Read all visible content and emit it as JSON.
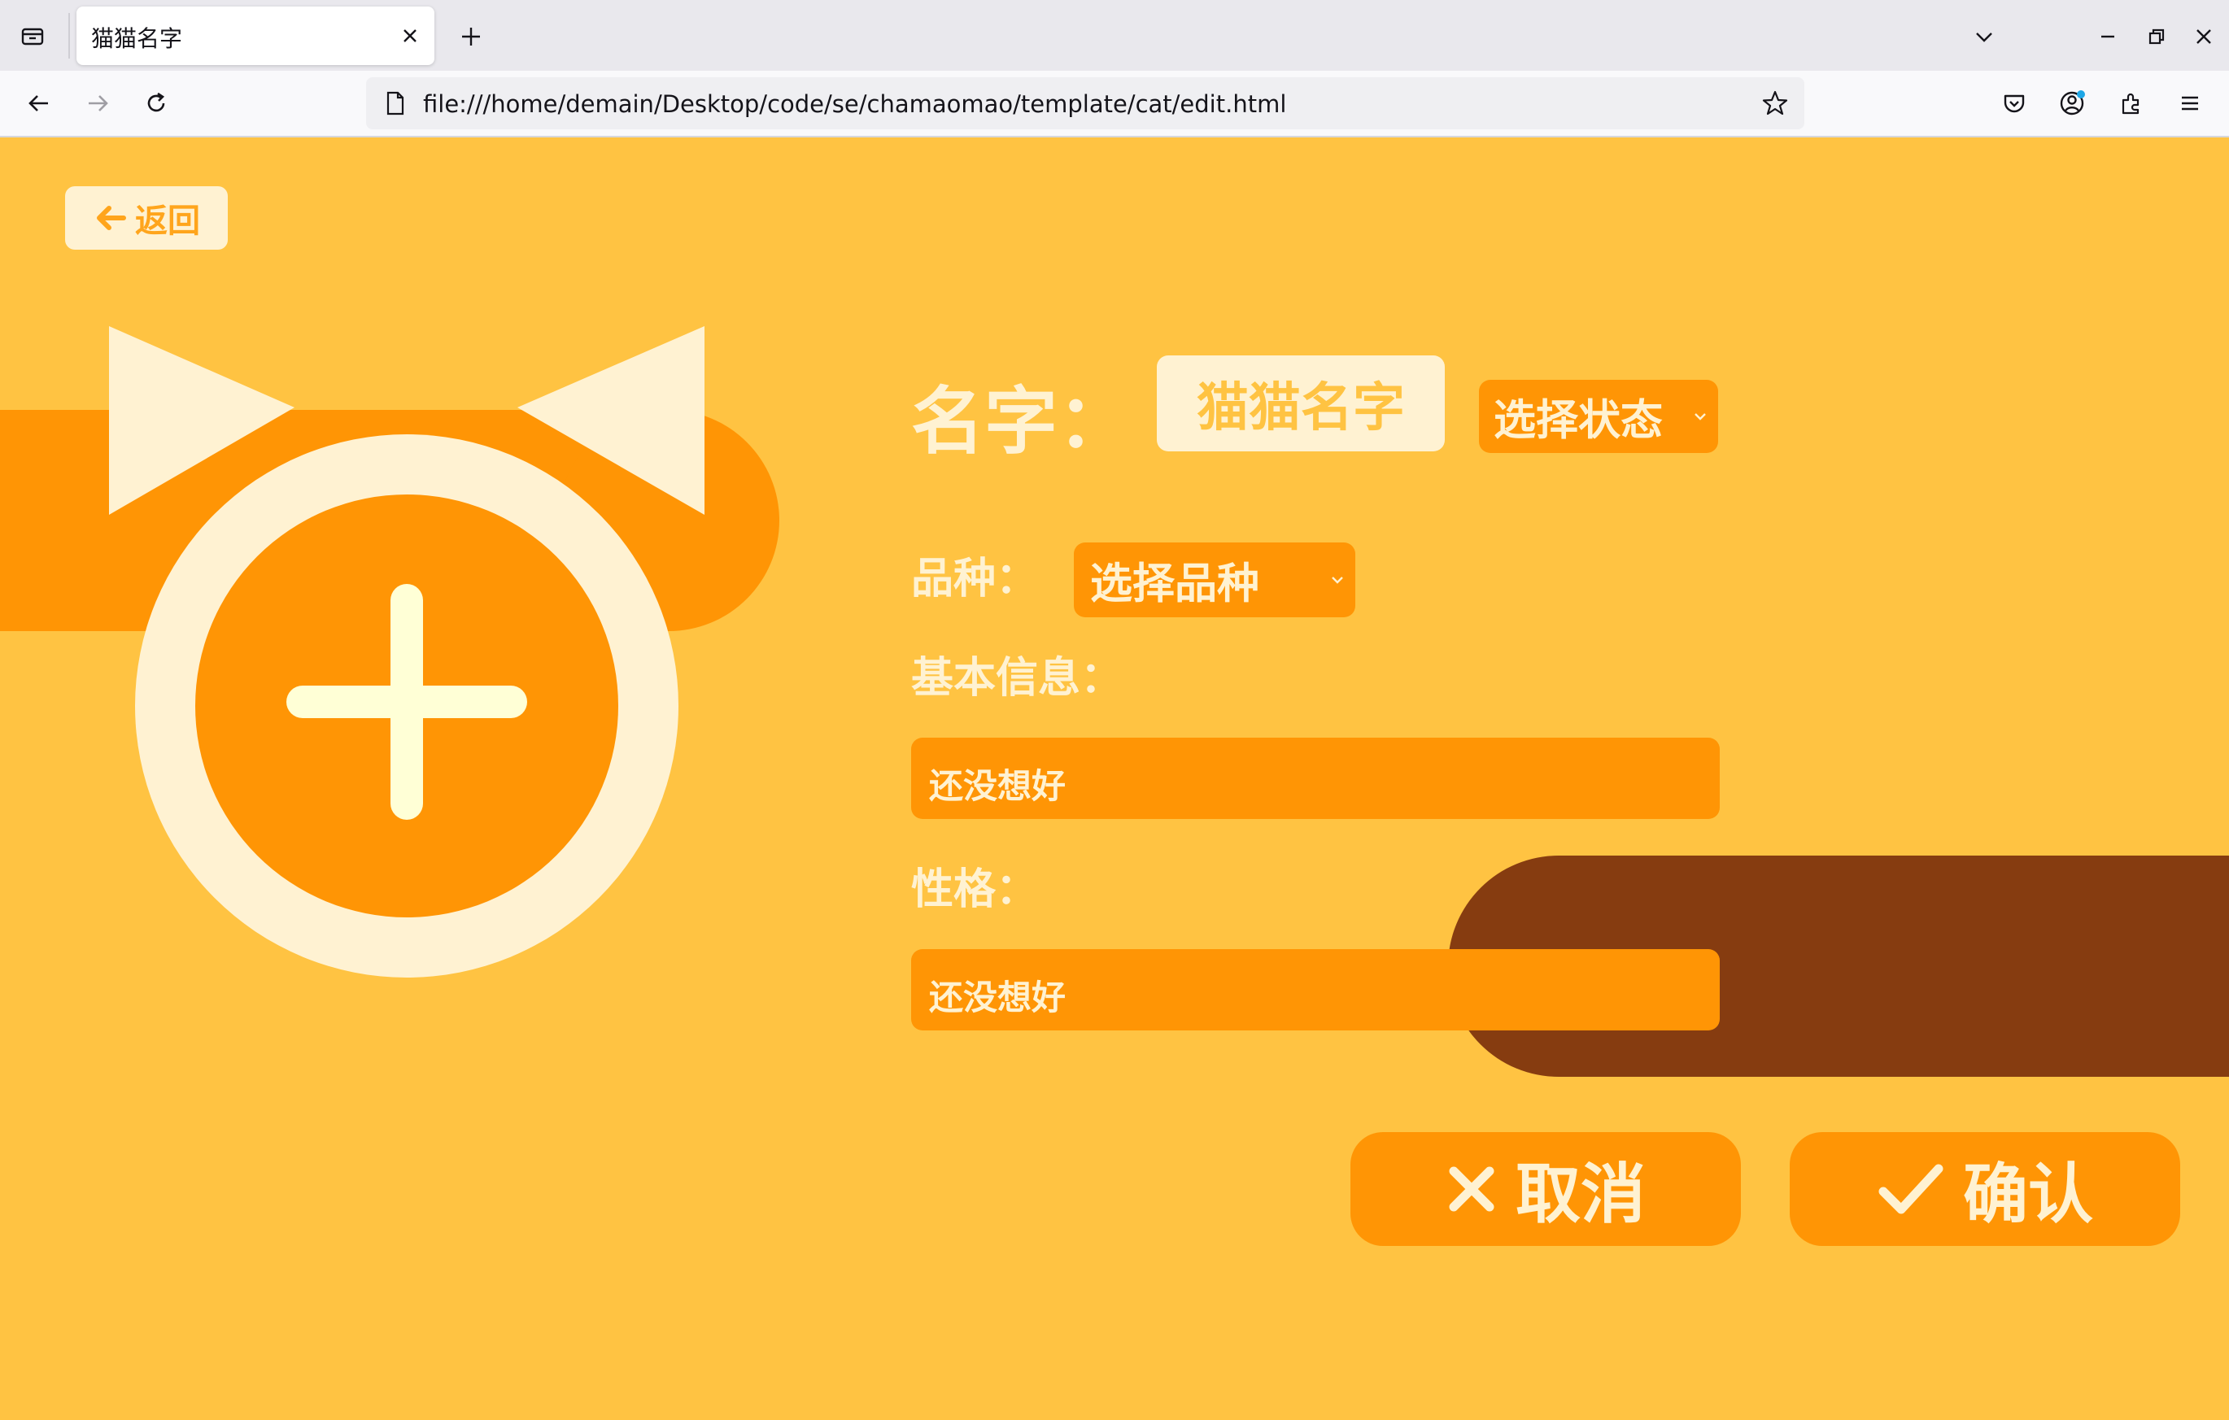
{
  "browser": {
    "tab_title": "猫猫名字",
    "url": "file:///home/demain/Desktop/code/se/chamaomao/template/cat/edit.html"
  },
  "page": {
    "back_label": "返回",
    "name_label": "名字：",
    "name_value": "猫猫名字",
    "status_select": "选择状态",
    "breed_label": "品种：",
    "breed_select": "选择品种",
    "basic_info_label": "基本信息：",
    "basic_info_value": "还没想好",
    "personality_label": "性格：",
    "personality_value": "还没想好",
    "cancel_label": "取消",
    "confirm_label": "确认"
  },
  "colors": {
    "background": "#ffc342",
    "orange": "#ff9505",
    "cream": "#fff2d2",
    "brown": "#863c10"
  },
  "icons": [
    "tab-list-icon",
    "close-icon",
    "plus-icon",
    "chevron-down-icon",
    "minimize-icon",
    "restore-icon",
    "back-arrow-icon",
    "forward-arrow-icon",
    "reload-icon",
    "page-icon",
    "star-icon",
    "pocket-icon",
    "account-icon",
    "extensions-icon",
    "menu-icon",
    "add-photo-icon",
    "x-icon",
    "check-icon"
  ]
}
